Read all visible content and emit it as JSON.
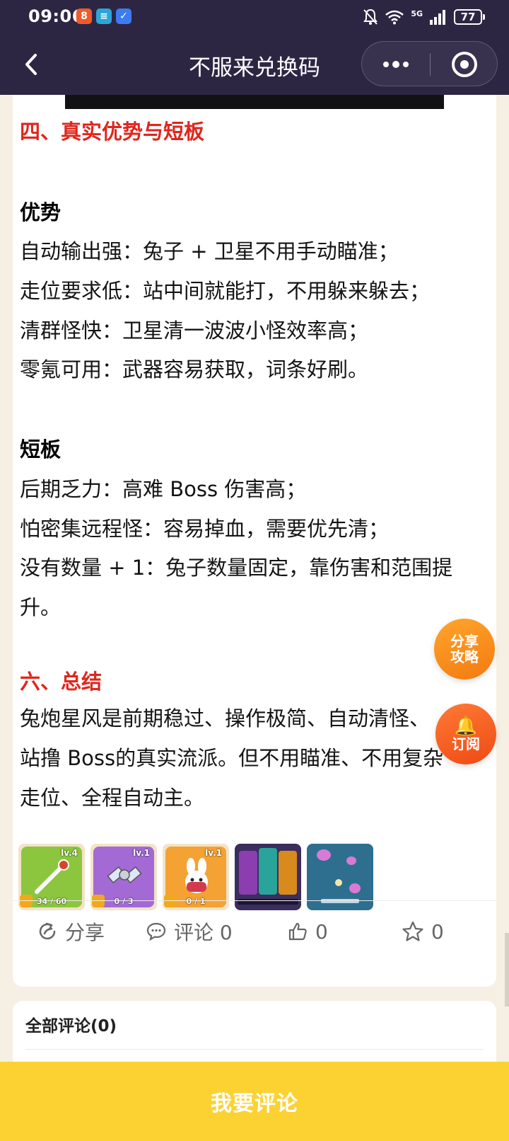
{
  "status_bar": {
    "time": "09:06",
    "apps": [
      "8",
      "≡",
      "✓"
    ],
    "network": "5G",
    "battery": "77"
  },
  "navbar": {
    "title": "不服来兑换码",
    "back_icon": "chevron-left-icon",
    "more_icon": "more-dots-icon",
    "close_icon": "target-close-icon"
  },
  "article": {
    "section4_title": "四、真实优势与短板",
    "advantages_title": "优势",
    "advantages": [
      "自动输出强：兔子 + 卫星不用手动瞄准；",
      "走位要求低：站中间就能打，不用躲来躲去；",
      "清群怪快：卫星清一波波小怪效率高；",
      "零氪可用：武器容易获取，词条好刷。"
    ],
    "weakness_title": "短板",
    "weaknesses": [
      "后期乏力：高难 Boss 伤害高；",
      "怕密集远程怪：容易掉血，需要优先清；",
      "没有数量 + 1：兔子数量固定，靠伤害和范围提",
      "升。"
    ],
    "section6_title": "六、总结",
    "summary": [
      "兔炮星风是前期稳过、操作极简、自动清怪、",
      "站撸 Boss的真实流派。但不用瞄准、不用复杂",
      "走位、全程自动主。"
    ]
  },
  "thumbnails": [
    {
      "label": "lv.4",
      "count": "34 / 60",
      "color": "#8cc63f"
    },
    {
      "label": "lv.1",
      "count": "0 / 3",
      "color": "#a36ad6"
    },
    {
      "label": "lv.1",
      "count": "0 / 1",
      "color": "#f4a233"
    },
    {
      "label": "",
      "count": "",
      "color": "#3b2d5e"
    },
    {
      "label": "",
      "count": "",
      "color": "#2e6f8f"
    }
  ],
  "actions": {
    "share_label": "分享",
    "comment_label": "评论 0",
    "like_count": "0",
    "star_count": "0"
  },
  "fabs": {
    "share_line1": "分享",
    "share_line2": "攻略",
    "subscribe": "订阅"
  },
  "comments": {
    "title": "全部评论(0)"
  },
  "bottom_button": "我要评论",
  "colors": {
    "header_bg": "#2d2643",
    "section_red": "#e0261d",
    "bottom_yellow": "#fcd233",
    "fab_orange": "#f37a10"
  }
}
